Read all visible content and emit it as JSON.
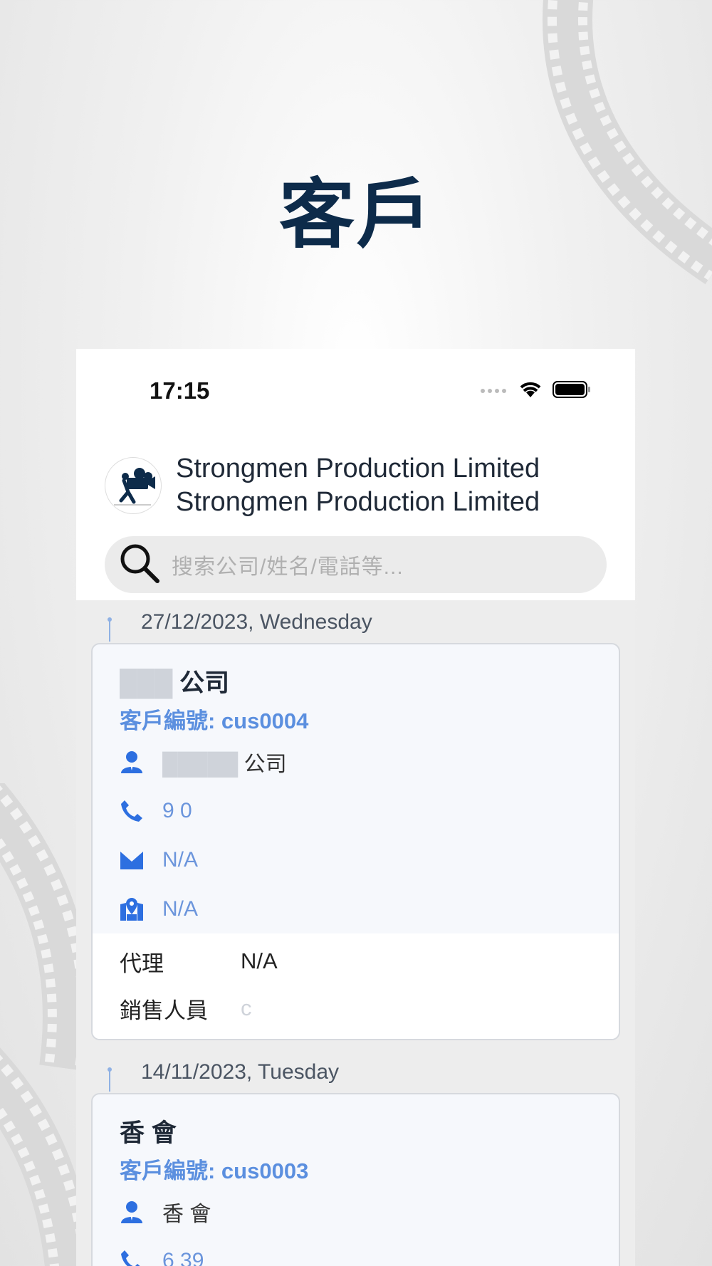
{
  "page_title": "客戶",
  "status_bar": {
    "time": "17:15"
  },
  "header": {
    "company_line1": "Strongmen Production Limited",
    "company_line2": "Strongmen Production Limited"
  },
  "search": {
    "placeholder": "搜索公司/姓名/電話等..."
  },
  "records": [
    {
      "date": "27/12/2023, Wednesday",
      "name": "公司",
      "customer_id": "客戶編號: cus0004",
      "contact": "公司",
      "phone": "9 0",
      "email": "N/A",
      "address": "N/A",
      "agent_label": "代理",
      "agent_value": "N/A",
      "sales_label": "銷售人員",
      "sales_value": "c"
    },
    {
      "date": "14/11/2023, Tuesday",
      "name": "香 會",
      "customer_id": "客戶編號: cus0003",
      "contact": "香 會",
      "phone": "6 39"
    }
  ],
  "colors": {
    "title": "#0d2b4a",
    "accent_blue": "#5b8fdf",
    "icon_blue": "#2d6fe0"
  }
}
